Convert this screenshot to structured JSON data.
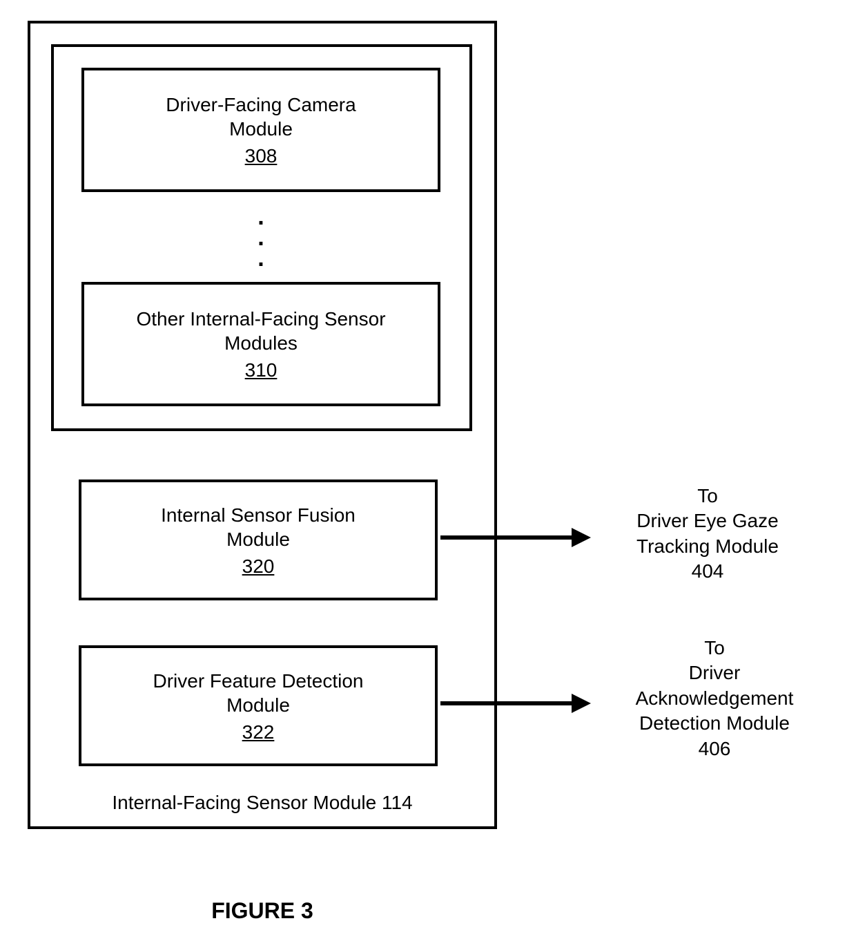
{
  "outer": {
    "caption": "Internal-Facing Sensor Module 114"
  },
  "inner": {
    "moduleA": {
      "title": "Driver-Facing Camera\nModule",
      "ref": "308"
    },
    "moduleB": {
      "title": "Other Internal-Facing Sensor\nModules",
      "ref": "310"
    }
  },
  "lower": {
    "moduleA": {
      "title": "Internal Sensor Fusion\nModule",
      "ref": "320"
    },
    "moduleB": {
      "title": "Driver Feature Detection\nModule",
      "ref": "322"
    }
  },
  "dest": {
    "a": "To\nDriver Eye Gaze\nTracking Module\n404",
    "b": "To\nDriver\nAcknowledgement\nDetection Module\n406"
  },
  "figure": "FIGURE 3"
}
